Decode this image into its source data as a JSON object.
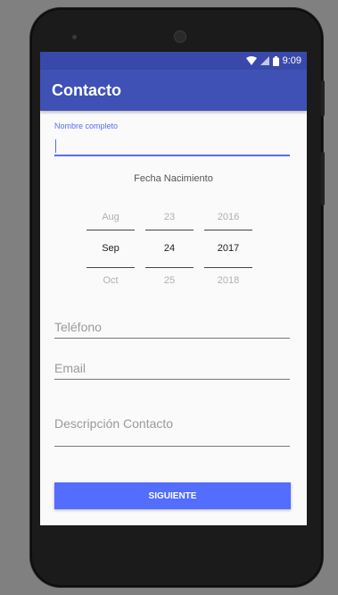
{
  "status_bar": {
    "time": "9:09"
  },
  "app_bar": {
    "title": "Contacto"
  },
  "form": {
    "name_label": "Nombre completo",
    "name_value": "",
    "birth_date_label": "Fecha Nacimiento",
    "date_picker": {
      "months": [
        "Aug",
        "Sep",
        "Oct"
      ],
      "days": [
        "23",
        "24",
        "25"
      ],
      "years": [
        "2016",
        "2017",
        "2018"
      ]
    },
    "phone_placeholder": "Teléfono",
    "email_placeholder": "Email",
    "description_placeholder": "Descripción Contacto",
    "submit_label": "SIGUIENTE"
  },
  "colors": {
    "primary": "#3f51b5",
    "primary_dark": "#3949ab",
    "accent": "#536dfe"
  },
  "icons": [
    "wifi-icon",
    "signal-icon",
    "battery-icon"
  ]
}
